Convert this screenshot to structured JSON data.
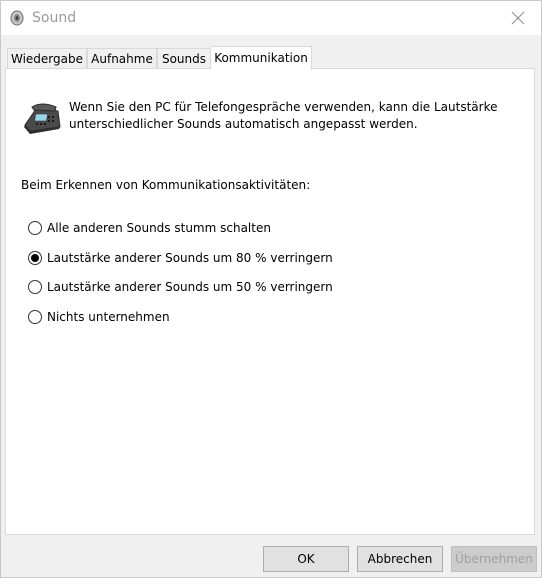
{
  "window": {
    "title": "Sound"
  },
  "tabs": [
    {
      "label": "Wiedergabe",
      "active": false
    },
    {
      "label": "Aufnahme",
      "active": false
    },
    {
      "label": "Sounds",
      "active": false
    },
    {
      "label": "Kommunikation",
      "active": true
    }
  ],
  "communication": {
    "intro_line1": "Wenn Sie den PC für Telefongespräche verwenden, kann die Lautstärke",
    "intro_line2": "unterschiedlicher Sounds automatisch angepasst werden.",
    "section_label": "Beim Erkennen von Kommunikationsaktivitäten:",
    "options": [
      {
        "label": "Alle anderen Sounds stumm schalten",
        "checked": false
      },
      {
        "label": "Lautstärke anderer Sounds um 80 % verringern",
        "checked": true
      },
      {
        "label": "Lautstärke anderer Sounds um 50 % verringern",
        "checked": false
      },
      {
        "label": "Nichts unternehmen",
        "checked": false
      }
    ]
  },
  "buttons": {
    "ok": "OK",
    "cancel": "Abbrechen",
    "apply": "Übernehmen",
    "apply_enabled": false
  },
  "icons": {
    "title": "speaker-icon",
    "close": "close-icon",
    "phone": "telephone-icon"
  }
}
